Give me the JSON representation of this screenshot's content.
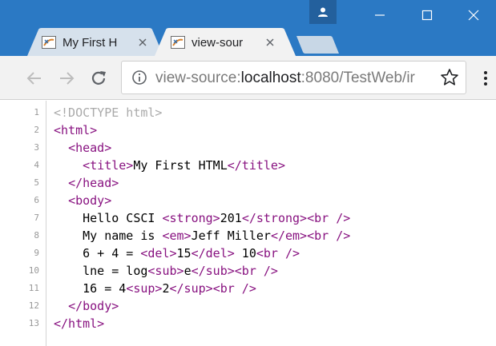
{
  "window": {
    "tabs": [
      {
        "label": "My First H",
        "favicon": "java-icon",
        "active": false
      },
      {
        "label": "view-sour",
        "favicon": "java-icon",
        "active": true
      }
    ]
  },
  "toolbar": {
    "url_prefix": "view-source:",
    "url_host": "localhost",
    "url_rest": ":8080/TestWeb/ir"
  },
  "colors": {
    "titlebar": "#2b79c4",
    "tag": "#881280",
    "doctype": "#aaaaaa",
    "line_number": "#999999"
  },
  "source": {
    "lines": [
      {
        "number": "1",
        "indent": "",
        "parts": [
          {
            "type": "doctype",
            "text": "<!DOCTYPE html>"
          }
        ]
      },
      {
        "number": "2",
        "indent": "",
        "parts": [
          {
            "type": "tag",
            "text": "<html>"
          }
        ]
      },
      {
        "number": "3",
        "indent": "  ",
        "parts": [
          {
            "type": "tag",
            "text": "<head>"
          }
        ]
      },
      {
        "number": "4",
        "indent": "    ",
        "parts": [
          {
            "type": "tag",
            "text": "<title>"
          },
          {
            "type": "text",
            "text": "My First HTML"
          },
          {
            "type": "tag",
            "text": "</title>"
          }
        ]
      },
      {
        "number": "5",
        "indent": "  ",
        "parts": [
          {
            "type": "tag",
            "text": "</head>"
          }
        ]
      },
      {
        "number": "6",
        "indent": "  ",
        "parts": [
          {
            "type": "tag",
            "text": "<body>"
          }
        ]
      },
      {
        "number": "7",
        "indent": "    ",
        "parts": [
          {
            "type": "text",
            "text": "Hello CSCI "
          },
          {
            "type": "tag",
            "text": "<strong>"
          },
          {
            "type": "text",
            "text": "201"
          },
          {
            "type": "tag",
            "text": "</strong>"
          },
          {
            "type": "tag",
            "text": "<br />"
          }
        ]
      },
      {
        "number": "8",
        "indent": "    ",
        "parts": [
          {
            "type": "text",
            "text": "My name is "
          },
          {
            "type": "tag",
            "text": "<em>"
          },
          {
            "type": "text",
            "text": "Jeff Miller"
          },
          {
            "type": "tag",
            "text": "</em>"
          },
          {
            "type": "tag",
            "text": "<br />"
          }
        ]
      },
      {
        "number": "9",
        "indent": "    ",
        "parts": [
          {
            "type": "text",
            "text": "6 + 4 = "
          },
          {
            "type": "tag",
            "text": "<del>"
          },
          {
            "type": "text",
            "text": "15"
          },
          {
            "type": "tag",
            "text": "</del>"
          },
          {
            "type": "text",
            "text": " 10"
          },
          {
            "type": "tag",
            "text": "<br />"
          }
        ]
      },
      {
        "number": "10",
        "indent": "    ",
        "parts": [
          {
            "type": "text",
            "text": "lne = log"
          },
          {
            "type": "tag",
            "text": "<sub>"
          },
          {
            "type": "text",
            "text": "e"
          },
          {
            "type": "tag",
            "text": "</sub>"
          },
          {
            "type": "tag",
            "text": "<br />"
          }
        ]
      },
      {
        "number": "11",
        "indent": "    ",
        "parts": [
          {
            "type": "text",
            "text": "16 = 4"
          },
          {
            "type": "tag",
            "text": "<sup>"
          },
          {
            "type": "text",
            "text": "2"
          },
          {
            "type": "tag",
            "text": "</sup>"
          },
          {
            "type": "tag",
            "text": "<br />"
          }
        ]
      },
      {
        "number": "12",
        "indent": "  ",
        "parts": [
          {
            "type": "tag",
            "text": "</body>"
          }
        ]
      },
      {
        "number": "13",
        "indent": "",
        "parts": [
          {
            "type": "tag",
            "text": "</html>"
          }
        ]
      }
    ]
  }
}
